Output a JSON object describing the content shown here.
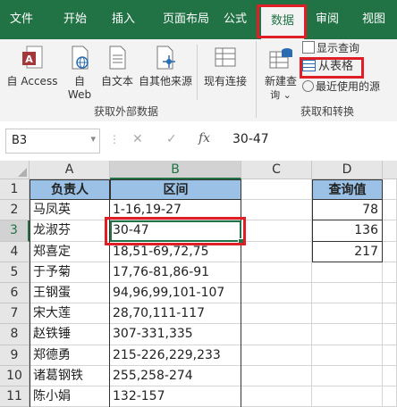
{
  "ribbon": {
    "tabs": [
      "文件",
      "开始",
      "插入",
      "页面布局",
      "公式",
      "数据",
      "审阅",
      "视图"
    ],
    "active_tab": "数据",
    "buttons": {
      "from_access": "自 Access",
      "from_web_1": "自",
      "from_web_2": "Web",
      "from_text": "自文本",
      "from_other": "自其他来源",
      "existing": "现有连接",
      "new_query_1": "新建查",
      "new_query_2": "询",
      "show_queries": "显示查询",
      "from_table": "从表格",
      "recent_sources": "最近使用的源"
    },
    "groups": {
      "external": "获取外部数据",
      "transform": "获取和转换"
    }
  },
  "formula_bar": {
    "name_box": "B3",
    "fx": "fx",
    "value": "30-47"
  },
  "sheet": {
    "columns": [
      "A",
      "B",
      "C",
      "D"
    ],
    "rows": [
      {
        "n": "1",
        "a": "负责人",
        "b": "区间",
        "d": "查询值"
      },
      {
        "n": "2",
        "a": "马凤英",
        "b": "1-16,19-27",
        "d": "78"
      },
      {
        "n": "3",
        "a": "龙淑芬",
        "b": "30-47",
        "d": "136"
      },
      {
        "n": "4",
        "a": "郑喜定",
        "b": "18,51-69,72,75",
        "d": "217"
      },
      {
        "n": "5",
        "a": "于予菊",
        "b": "17,76-81,86-91",
        "d": ""
      },
      {
        "n": "6",
        "a": "王钢蛋",
        "b": "94,96,99,101-107",
        "d": ""
      },
      {
        "n": "7",
        "a": "宋大莲",
        "b": "28,70,111-117",
        "d": ""
      },
      {
        "n": "8",
        "a": "赵铁锤",
        "b": "307-331,335",
        "d": ""
      },
      {
        "n": "9",
        "a": "郑德勇",
        "b": "215-226,229,233",
        "d": ""
      },
      {
        "n": "10",
        "a": "诸葛钢铁",
        "b": "255,258-274",
        "d": ""
      },
      {
        "n": "11",
        "a": "陈小娟",
        "b": "132-157",
        "d": ""
      }
    ]
  },
  "colors": {
    "accent": "#217346",
    "header_fill": "#9bc2e6",
    "highlight": "#e01e26"
  }
}
